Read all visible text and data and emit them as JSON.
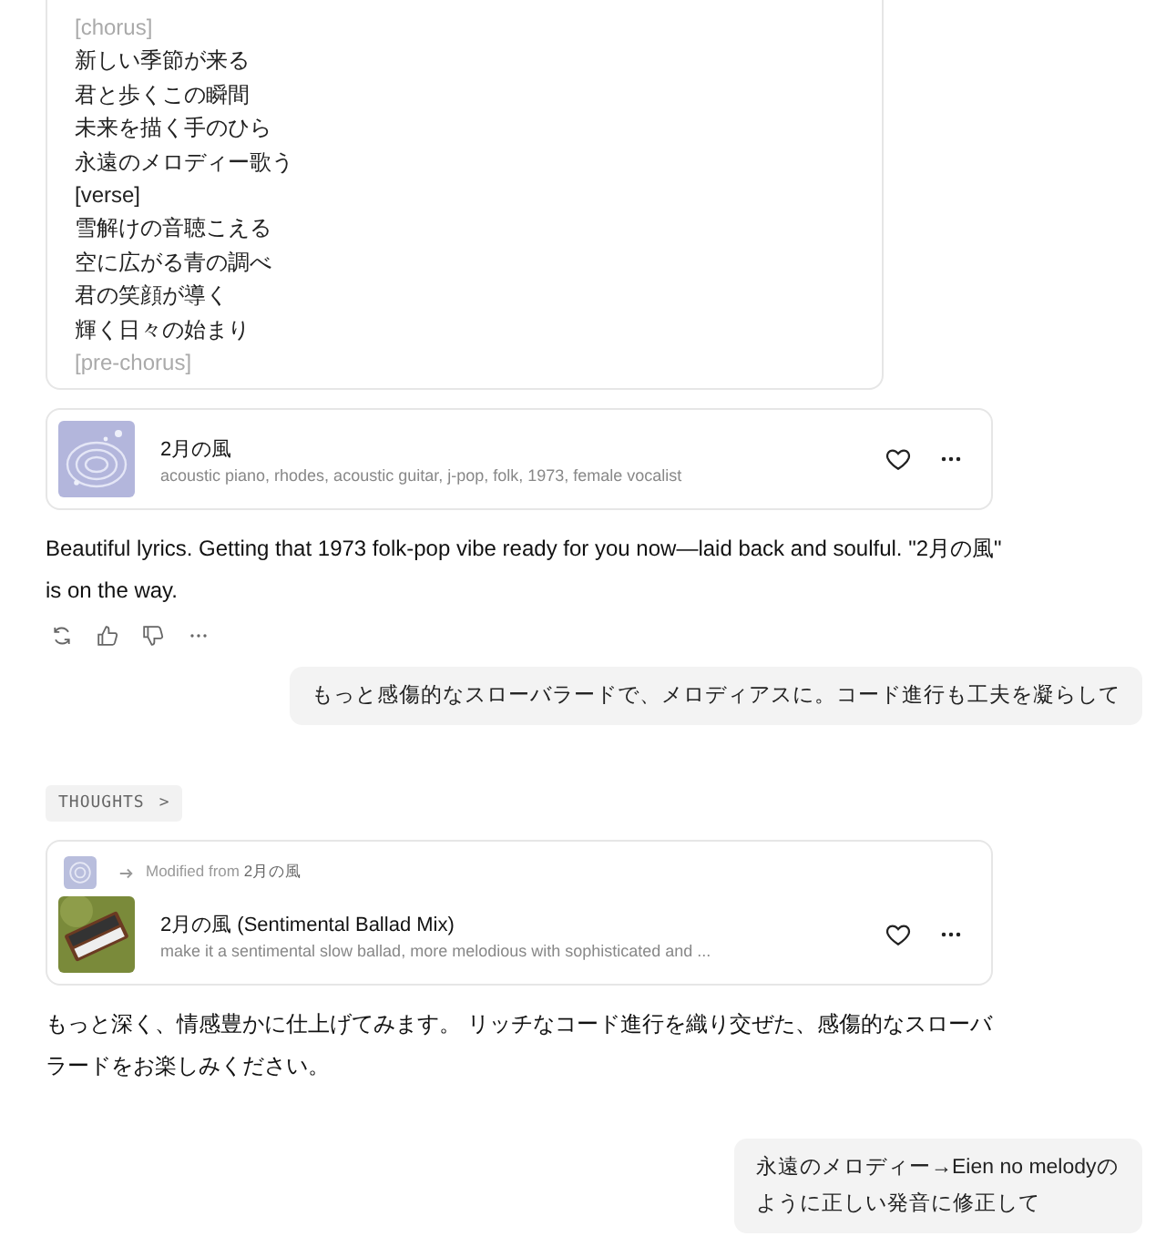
{
  "lyrics": [
    {
      "text": "[chorus]",
      "faded": true
    },
    {
      "text": "新しい季節が来る",
      "faded": false
    },
    {
      "text": "君と歩くこの瞬間",
      "faded": false
    },
    {
      "text": "未来を描く手のひら",
      "faded": false
    },
    {
      "text": "永遠のメロディー歌う",
      "faded": false
    },
    {
      "text": "[verse]",
      "faded": false
    },
    {
      "text": "雪解けの音聴こえる",
      "faded": false
    },
    {
      "text": "空に広がる青の調べ",
      "faded": false
    },
    {
      "text": "君の笑顔が導く",
      "faded": false
    },
    {
      "text": "輝く日々の始まり",
      "faded": false
    },
    {
      "text": "[pre-chorus]",
      "faded": true
    }
  ],
  "messages": [
    {
      "kind": "song",
      "title": "2月の風",
      "tags": "acoustic piano, rhodes, acoustic guitar, j-pop, folk, 1973, female vocalist"
    },
    {
      "kind": "assistant",
      "text": "Beautiful lyrics. Getting that 1973 folk-pop vibe ready for you now—laid back and soulful. \"2月の風\" is on the way.",
      "actions": true
    },
    {
      "kind": "user",
      "text": "もっと感傷的なスローバラードで、メロディアスに。コード進行も工夫を凝らして"
    },
    {
      "kind": "thoughts",
      "label": "THOUGHTS",
      "chevron": ">"
    },
    {
      "kind": "song",
      "modified_prefix": "Modified from",
      "modified_from": "2月の風",
      "title": "2月の風 (Sentimental Ballad Mix)",
      "tags": "make it a sentimental slow ballad, more melodious with sophisticated and ..."
    },
    {
      "kind": "assistant",
      "text": "もっと深く、情感豊かに仕上げてみます。 リッチなコード進行を織り交ぜた、感傷的なスローバラードをお楽しみください。",
      "actions": false
    },
    {
      "kind": "user",
      "text": "永遠のメロディー→Eien no melodyのように正しい発音に修正して"
    }
  ]
}
